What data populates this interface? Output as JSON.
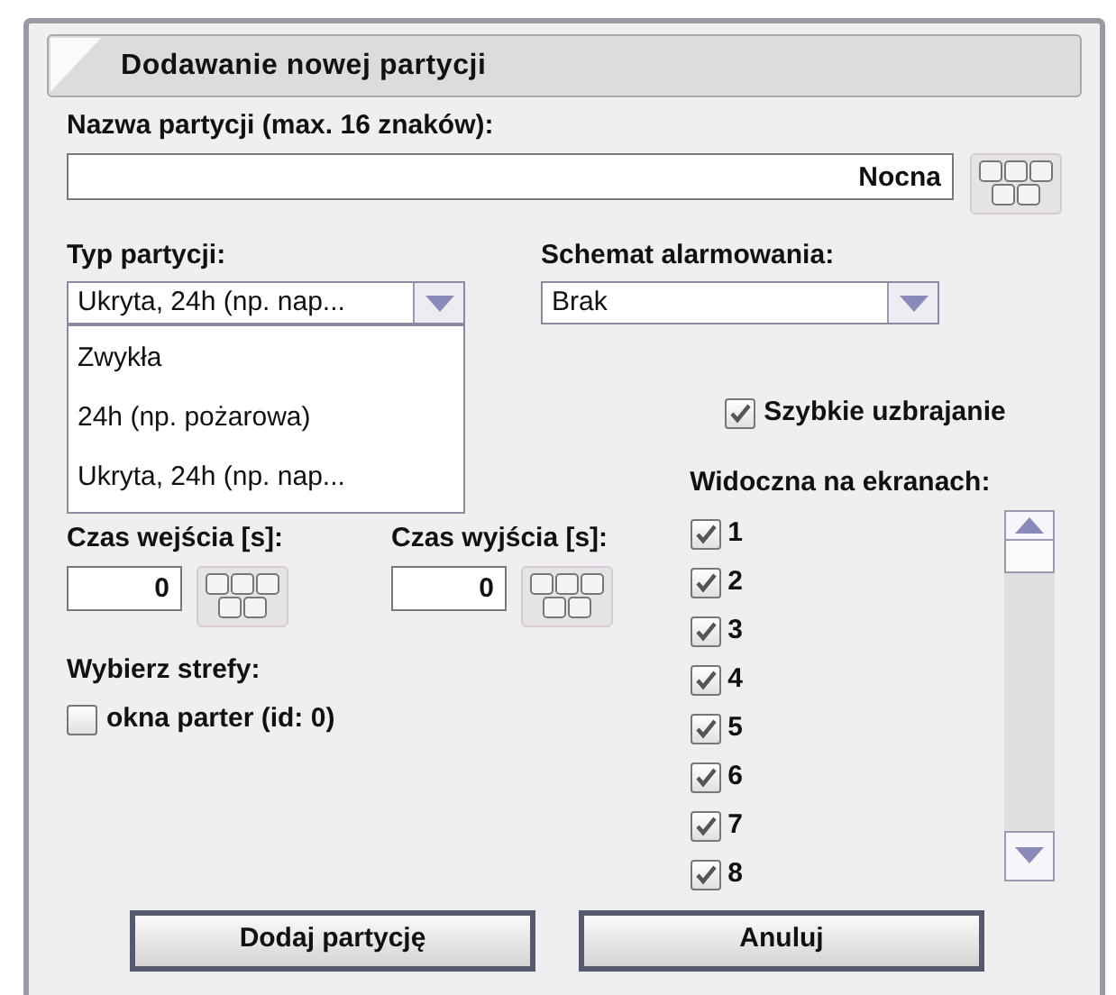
{
  "window": {
    "title": "Dodawanie nowej partycji"
  },
  "name_field": {
    "label": "Nazwa partycji (max. 16 znaków):",
    "value": "Nocna"
  },
  "partition_type": {
    "label": "Typ partycji:",
    "value": "Ukryta, 24h (np. nap...",
    "expanded": true,
    "options": [
      {
        "label": "Zwykła"
      },
      {
        "label": "24h (np. pożarowa)"
      },
      {
        "label": "Ukryta, 24h (np. nap..."
      }
    ]
  },
  "alarm_scheme": {
    "label": "Schemat alarmowania:",
    "value": "Brak"
  },
  "quick_arming": {
    "label": "Szybkie uzbrajanie",
    "checked": true
  },
  "screens": {
    "label": "Widoczna na ekranach:",
    "items": [
      {
        "label": "1",
        "checked": true
      },
      {
        "label": "2",
        "checked": true
      },
      {
        "label": "3",
        "checked": true
      },
      {
        "label": "4",
        "checked": true
      },
      {
        "label": "5",
        "checked": true
      },
      {
        "label": "6",
        "checked": true
      },
      {
        "label": "7",
        "checked": true
      },
      {
        "label": "8",
        "checked": true
      }
    ]
  },
  "entry_time": {
    "label": "Czas wejścia [s]:",
    "value": "0"
  },
  "exit_time": {
    "label": "Czas wyjścia [s]:",
    "value": "0"
  },
  "zones": {
    "label": "Wybierz strefy:",
    "items": [
      {
        "label": "okna parter (id: 0)",
        "checked": false
      }
    ]
  },
  "buttons": [
    {
      "label": "Dodaj partycję"
    },
    {
      "label": "Anuluj"
    }
  ]
}
